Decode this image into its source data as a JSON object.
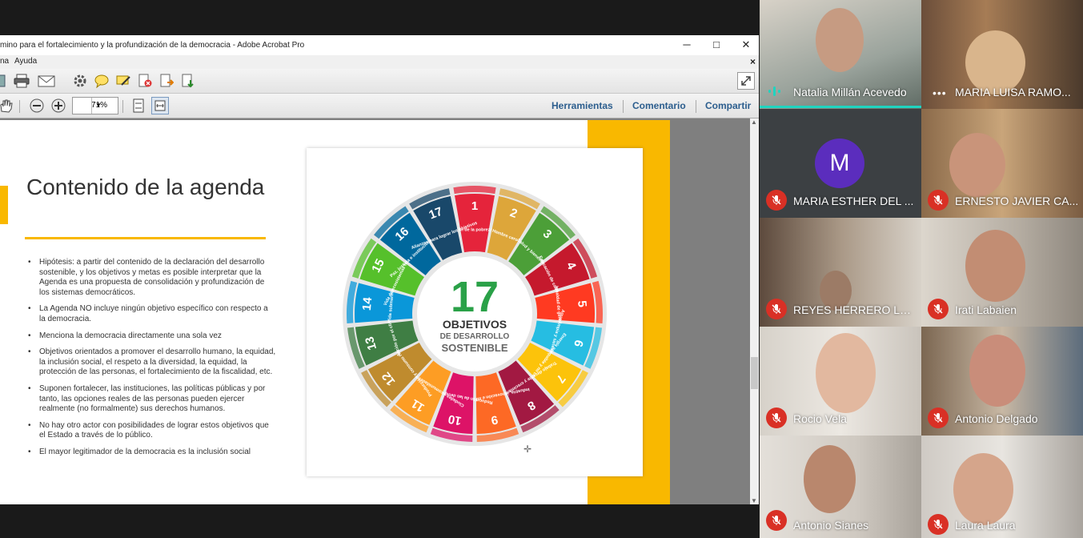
{
  "acrobat": {
    "title": "mino para el fortalecimiento y la profundización de la democracia - Adobe Acrobat Pro",
    "window_controls": {
      "minimize": "─",
      "maximize": "□",
      "close": "✕"
    },
    "menu": {
      "item1": "na",
      "item2": "Ayuda",
      "close": "×"
    },
    "zoom": "71%",
    "right_links": {
      "tools": "Herramientas",
      "comment": "Comentario",
      "share": "Compartir"
    }
  },
  "slide": {
    "title": "Contenido de la agenda",
    "bullets": [
      "Hipótesis: a partir del contenido de la declaración del desarrollo sostenible,  y los objetivos y metas es posible interpretar que la Agenda es una propuesta de consolidación y profundización de los sistemas democráticos.",
      "La Agenda NO incluye ningún objetivo específico con respecto a la democracia.",
      "Menciona la democracia directamente una sola vez",
      "Objetivos orientados a promover el desarrollo humano, la equidad, la inclusión social, el respeto a la diversidad, la equidad, la protección de las personas, el fortalecimiento de la fiscalidad, etc.",
      "Suponen fortalecer, las instituciones, las políticas públicas y por tanto, las opciones reales de las personas pueden ejercer realmente (no formalmente) sus derechos humanos.",
      "No hay otro actor con posibilidades de lograr estos objetivos que el Estado a través de lo público.",
      "El mayor legitimador de la democracia es la inclusión social"
    ],
    "sdg": {
      "number": "17",
      "line1": "OBJETIVOS",
      "line2": "DE DESARROLLO",
      "line3": "SOSTENIBLE",
      "goals": [
        {
          "n": "1",
          "label": "Fin de la pobreza",
          "color": "#e5243b"
        },
        {
          "n": "2",
          "label": "Hambre cero",
          "color": "#dda63a"
        },
        {
          "n": "3",
          "label": "Salud y bienestar",
          "color": "#4c9f38"
        },
        {
          "n": "4",
          "label": "Educación de calidad",
          "color": "#c5192d"
        },
        {
          "n": "5",
          "label": "Igualdad de género",
          "color": "#ff3a21"
        },
        {
          "n": "6",
          "label": "Agua limpia y saneamiento",
          "color": "#26bde2"
        },
        {
          "n": "7",
          "label": "Energía asequible y no contaminante",
          "color": "#fcc30b"
        },
        {
          "n": "8",
          "label": "Trabajo decente y crecimiento económico",
          "color": "#a21942"
        },
        {
          "n": "9",
          "label": "Industria, innovación e infraestructura",
          "color": "#fd6925"
        },
        {
          "n": "10",
          "label": "Reducción de las desigualdades",
          "color": "#dd1367"
        },
        {
          "n": "11",
          "label": "Ciudades y comunidades sostenibles",
          "color": "#fd9d24"
        },
        {
          "n": "12",
          "label": "Producción y consumo responsables",
          "color": "#bf8b2e"
        },
        {
          "n": "13",
          "label": "Acción por el clima",
          "color": "#3f7e44"
        },
        {
          "n": "14",
          "label": "Vida submarina",
          "color": "#0a97d9"
        },
        {
          "n": "15",
          "label": "Vida de ecosistemas terrestres",
          "color": "#56c02b"
        },
        {
          "n": "16",
          "label": "Paz, justicia e instituciones sólidas",
          "color": "#00689d"
        },
        {
          "n": "17",
          "label": "Alianzas para lograr los objetivos",
          "color": "#19486a"
        }
      ]
    }
  },
  "participants": [
    {
      "name": "Natalia Millán Acevedo",
      "status": "speaking",
      "active": true
    },
    {
      "name": "MARIA LUISA RAMO...",
      "status": "more"
    },
    {
      "name": "MARIA ESTHER DEL ...",
      "status": "muted",
      "initial": "M"
    },
    {
      "name": "ERNESTO JAVIER CA...",
      "status": "muted"
    },
    {
      "name": "REYES HERRERO LO...",
      "status": "muted"
    },
    {
      "name": "Irati Labaien",
      "status": "muted"
    },
    {
      "name": "Rocio Vela",
      "status": "muted"
    },
    {
      "name": "Antonio Delgado",
      "status": "muted"
    },
    {
      "name": "Antonio Sianes",
      "status": "muted"
    },
    {
      "name": "Laura Laura",
      "status": "muted"
    }
  ],
  "colors": {
    "accent_yellow": "#f9b800",
    "link_blue": "#2c5e8e",
    "mute_red": "#d93025",
    "active_teal": "#1fd4c0",
    "avatar_purple": "#5b2dbd"
  }
}
